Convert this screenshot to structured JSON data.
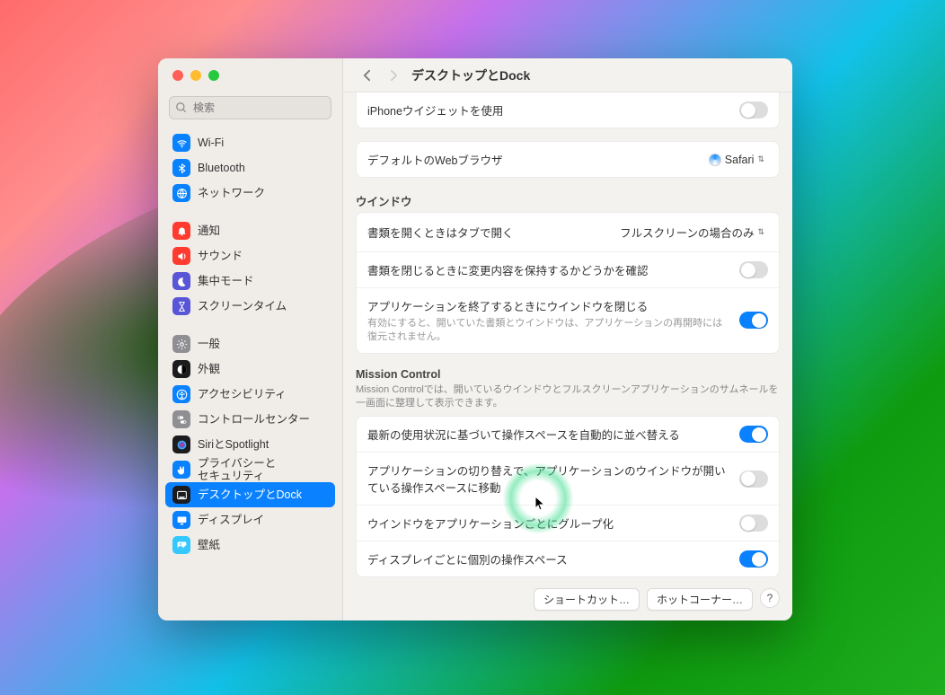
{
  "search": {
    "placeholder": "検索"
  },
  "header": {
    "title": "デスクトップとDock"
  },
  "sidebar": {
    "groups": [
      {
        "items": [
          {
            "label": "Wi-Fi",
            "color": "#0a82ff",
            "icon": "wifi"
          },
          {
            "label": "Bluetooth",
            "color": "#0a82ff",
            "icon": "bluetooth"
          },
          {
            "label": "ネットワーク",
            "color": "#0a82ff",
            "icon": "globe"
          }
        ]
      },
      {
        "items": [
          {
            "label": "通知",
            "color": "#ff3b30",
            "icon": "bell"
          },
          {
            "label": "サウンド",
            "color": "#ff3b30",
            "icon": "speaker"
          },
          {
            "label": "集中モード",
            "color": "#5856d6",
            "icon": "moon"
          },
          {
            "label": "スクリーンタイム",
            "color": "#5856d6",
            "icon": "hourglass"
          }
        ]
      },
      {
        "items": [
          {
            "label": "一般",
            "color": "#8e8e93",
            "icon": "gear"
          },
          {
            "label": "外観",
            "color": "#1c1c1e",
            "icon": "appearance"
          },
          {
            "label": "アクセシビリティ",
            "color": "#0a82ff",
            "icon": "accessibility"
          },
          {
            "label": "コントロールセンター",
            "color": "#8e8e93",
            "icon": "switches"
          },
          {
            "label": "SiriとSpotlight",
            "color": "#1c1c1e",
            "icon": "siri"
          },
          {
            "label": "プライバシーと\nセキュリティ",
            "color": "#0a82ff",
            "icon": "hand"
          },
          {
            "label": "デスクトップとDock",
            "color": "#1c1c1e",
            "icon": "dock",
            "selected": true
          },
          {
            "label": "ディスプレイ",
            "color": "#0a82ff",
            "icon": "display"
          },
          {
            "label": "壁紙",
            "color": "#34c8ff",
            "icon": "wallpaper"
          }
        ]
      }
    ]
  },
  "widgets_row": {
    "label": "iPhoneウイジェットを使用",
    "value": false
  },
  "browser_row": {
    "label": "デフォルトのWebブラウザ",
    "value": "Safari"
  },
  "windows": {
    "title": "ウインドウ",
    "tab_row": {
      "label": "書類を開くときはタブで開く",
      "value": "フルスクリーンの場合のみ"
    },
    "confirm_row": {
      "label": "書類を閉じるときに変更内容を保持するかどうかを確認",
      "value": false
    },
    "close_row": {
      "label": "アプリケーションを終了するときにウインドウを閉じる",
      "sub": "有効にすると、開いていた書類とウインドウは、アプリケーションの再開時には復元されません。",
      "value": true
    }
  },
  "mission": {
    "title": "Mission Control",
    "sub": "Mission Controlでは、開いているウインドウとフルスクリーンアプリケーションのサムネールを一画面に整理して表示できます。",
    "auto_row": {
      "label": "最新の使用状況に基づいて操作スペースを自動的に並べ替える",
      "value": true
    },
    "switch_row": {
      "label": "アプリケーションの切り替えで、アプリケーションのウインドウが開いている操作スペースに移動",
      "value": false
    },
    "group_row": {
      "label": "ウインドウをアプリケーションごとにグループ化",
      "value": false
    },
    "display_row": {
      "label": "ディスプレイごとに個別の操作スペース",
      "value": true
    }
  },
  "footer": {
    "shortcuts": "ショートカット…",
    "hotcorners": "ホットコーナー…",
    "help": "?"
  }
}
